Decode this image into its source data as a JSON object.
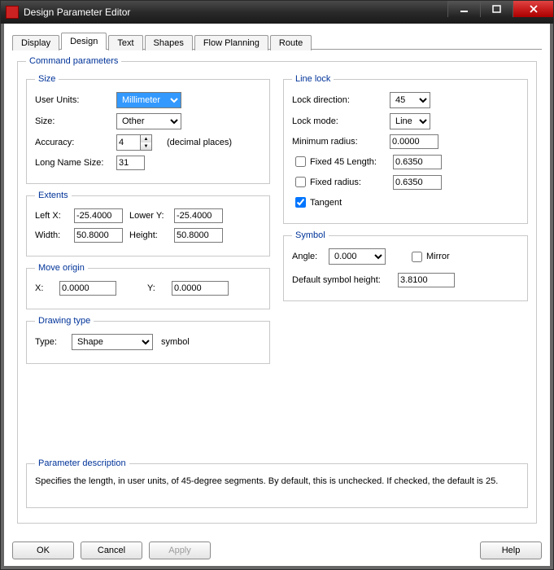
{
  "window": {
    "title": "Design Parameter Editor"
  },
  "tabs": [
    "Display",
    "Design",
    "Text",
    "Shapes",
    "Flow Planning",
    "Route"
  ],
  "active_tab": 1,
  "group": {
    "command_parameters": "Command parameters",
    "size": "Size",
    "extents": "Extents",
    "move_origin": "Move origin",
    "drawing_type": "Drawing type",
    "line_lock": "Line lock",
    "symbol": "Symbol",
    "parameter_description": "Parameter description"
  },
  "size": {
    "user_units_label": "User Units:",
    "user_units_value": "Millimeter",
    "size_label": "Size:",
    "size_value": "Other",
    "accuracy_label": "Accuracy:",
    "accuracy_value": "4",
    "accuracy_suffix": "(decimal places)",
    "long_name_label": "Long Name Size:",
    "long_name_value": "31"
  },
  "extents": {
    "leftx_label": "Left X:",
    "leftx_value": "-25.4000",
    "lowery_label": "Lower Y:",
    "lowery_value": "-25.4000",
    "width_label": "Width:",
    "width_value": "50.8000",
    "height_label": "Height:",
    "height_value": "50.8000"
  },
  "move_origin": {
    "x_label": "X:",
    "x_value": "0.0000",
    "y_label": "Y:",
    "y_value": "0.0000"
  },
  "drawing_type": {
    "type_label": "Type:",
    "type_value": "Shape",
    "type_suffix": "symbol"
  },
  "line_lock": {
    "lock_direction_label": "Lock direction:",
    "lock_direction_value": "45",
    "lock_mode_label": "Lock mode:",
    "lock_mode_value": "Line",
    "min_radius_label": "Minimum radius:",
    "min_radius_value": "0.0000",
    "fixed45_label": "Fixed 45 Length:",
    "fixed45_value": "0.6350",
    "fixed45_checked": false,
    "fixed_radius_label": "Fixed radius:",
    "fixed_radius_value": "0.6350",
    "fixed_radius_checked": false,
    "tangent_label": "Tangent",
    "tangent_checked": true
  },
  "symbol": {
    "angle_label": "Angle:",
    "angle_value": "0.000",
    "mirror_label": "Mirror",
    "mirror_checked": false,
    "default_height_label": "Default symbol height:",
    "default_height_value": "3.8100"
  },
  "description_text": "Specifies the length, in user units, of 45-degree segments. By default, this is unchecked. If checked, the default is 25.",
  "buttons": {
    "ok": "OK",
    "cancel": "Cancel",
    "apply": "Apply",
    "help": "Help"
  }
}
